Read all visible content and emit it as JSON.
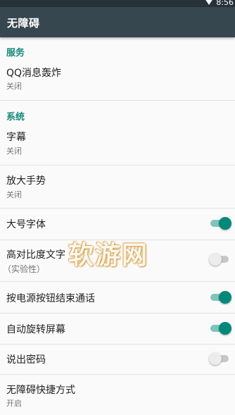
{
  "status_bar": {
    "time": "8:56",
    "wifi_icon": "wifi-icon"
  },
  "app_bar": {
    "title": "无障碍"
  },
  "sections": {
    "services": "服务",
    "system": "系统"
  },
  "items": {
    "qq_bomb": {
      "title": "QQ消息轰炸",
      "summary": "关闭"
    },
    "captions": {
      "title": "字幕",
      "summary": "关闭"
    },
    "magnify": {
      "title": "放大手势",
      "summary": "关闭"
    },
    "large_text": {
      "title": "大号字体",
      "checked": true
    },
    "high_contrast": {
      "title": "高对比度文字",
      "summary": "（实验性）",
      "checked": false
    },
    "power_end_call": {
      "title": "按电源按钮结束通话",
      "checked": true
    },
    "auto_rotate": {
      "title": "自动旋转屏幕",
      "checked": true
    },
    "speak_password": {
      "title": "说出密码",
      "checked": false
    },
    "shortcut": {
      "title": "无障碍快捷方式",
      "summary": "开启"
    }
  },
  "watermark": "软游网",
  "colors": {
    "accent": "#00897b",
    "section_header": "#15897b",
    "app_bar": "#37474f",
    "status_bar": "#263238"
  }
}
